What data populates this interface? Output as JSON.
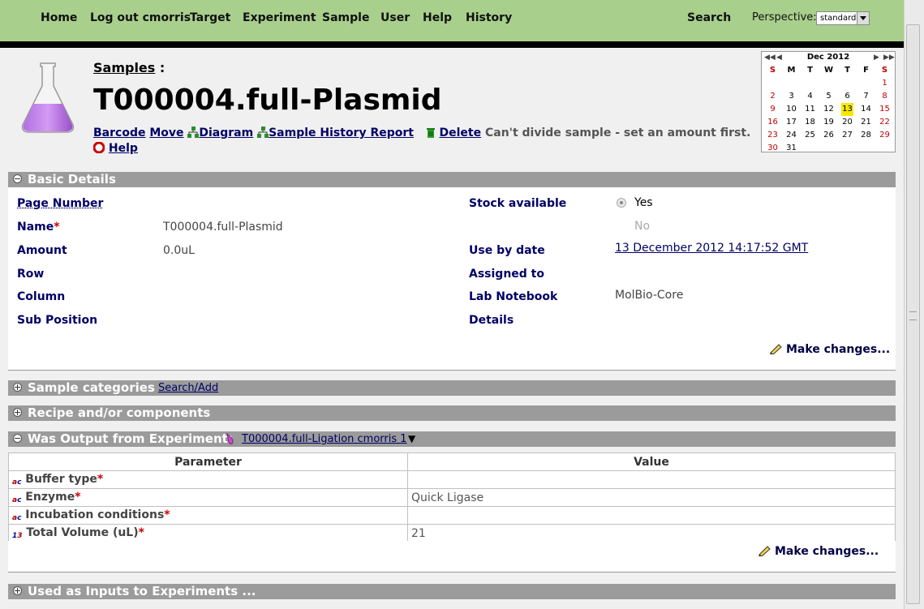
{
  "nav": {
    "items": [
      "Home",
      "Log out cmorris",
      "Target",
      "Experiment",
      "Sample",
      "User",
      "Help",
      "History"
    ],
    "search": "Search",
    "perspective_label": "Perspective:",
    "perspective_value": "standard"
  },
  "header": {
    "breadcrumb": "Samples",
    "breadcrumb_sep": ":",
    "title": "T000004.full-Plasmid",
    "actions": {
      "barcode": "Barcode",
      "move": "Move",
      "diagram": "Diagram",
      "history_report": "Sample History Report",
      "delete": "Delete",
      "note": "Can't divide sample - set an amount first.",
      "help": "Help"
    }
  },
  "calendar": {
    "month": "Dec 2012",
    "dow": [
      "S",
      "M",
      "T",
      "W",
      "T",
      "F",
      "S"
    ],
    "weeks": [
      [
        "",
        "",
        "",
        "",
        "",
        "",
        "1"
      ],
      [
        "2",
        "3",
        "4",
        "5",
        "6",
        "7",
        "8"
      ],
      [
        "9",
        "10",
        "11",
        "12",
        "13",
        "14",
        "15"
      ],
      [
        "16",
        "17",
        "18",
        "19",
        "20",
        "21",
        "22"
      ],
      [
        "23",
        "24",
        "25",
        "26",
        "27",
        "28",
        "29"
      ],
      [
        "30",
        "31",
        "",
        "",
        "",
        "",
        ""
      ]
    ],
    "today": "13"
  },
  "basic": {
    "header": "Basic Details",
    "page_number_label": "Page Number",
    "name_label": "Name",
    "name_value": "T000004.full-Plasmid",
    "amount_label": "Amount",
    "amount_value": "0.0uL",
    "row_label": "Row",
    "column_label": "Column",
    "sub_position_label": "Sub Position",
    "stock_label": "Stock available",
    "stock_yes": "Yes",
    "stock_no": "No",
    "use_by_label": "Use by date",
    "use_by_value": "13 December 2012 14:17:52 GMT",
    "assigned_label": "Assigned to",
    "notebook_label": "Lab Notebook",
    "notebook_value": "MolBio-Core",
    "details_label": "Details",
    "make_changes": "Make changes..."
  },
  "categories": {
    "header": "Sample categories",
    "search_add": "Search/Add"
  },
  "recipe": {
    "header": "Recipe and/or components"
  },
  "output": {
    "header": "Was Output from Experiment:",
    "experiment_link": "T000004.full-Ligation cmorris 1",
    "col_parameter": "Parameter",
    "col_value": "Value",
    "rows": [
      {
        "name": "Buffer type",
        "value": ""
      },
      {
        "name": "Enzyme",
        "value": "Quick Ligase"
      },
      {
        "name": "Incubation conditions",
        "value": ""
      },
      {
        "name": "Total Volume (uL)",
        "value": "21"
      }
    ],
    "make_changes": "Make changes..."
  },
  "inputs": {
    "header": "Used as Inputs to Experiments ..."
  },
  "colors": {
    "nav_bg": "#a8cf8c",
    "section_bar": "#9b9b9b",
    "label_blue": "#000066",
    "required": "#cc0000",
    "today": "#f7e700"
  }
}
